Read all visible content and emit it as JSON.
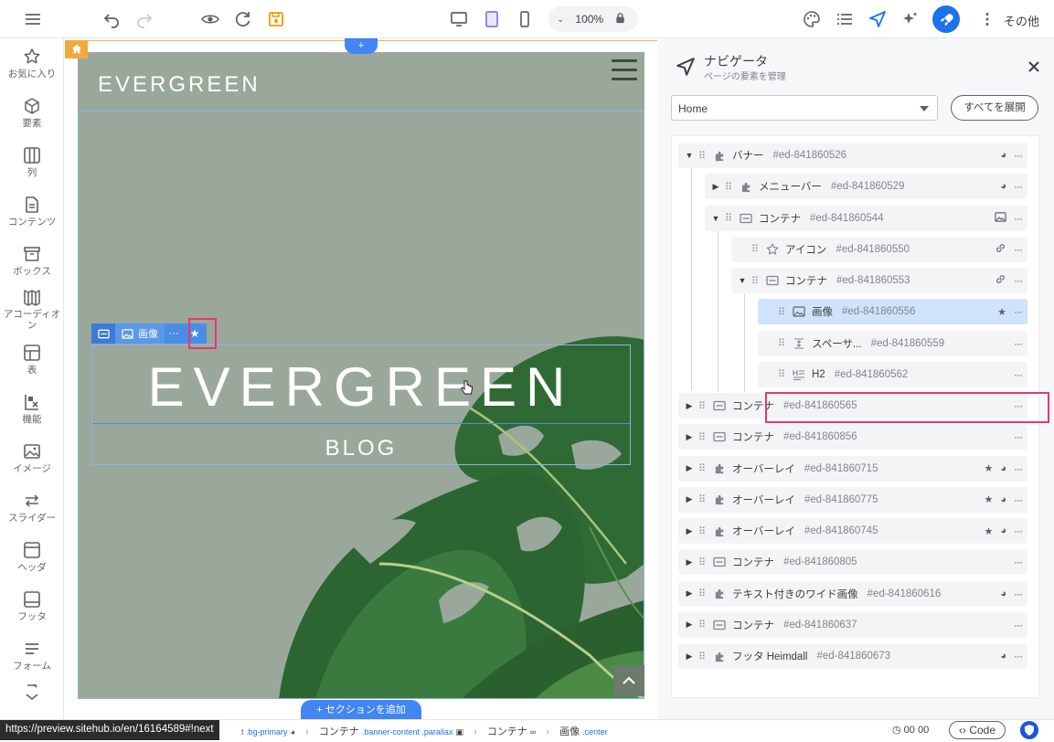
{
  "topbar": {
    "zoom": "100%",
    "more_label": "その他"
  },
  "sidebar": {
    "items": [
      {
        "label": "お気に入り",
        "icon": "star-icon"
      },
      {
        "label": "要素",
        "icon": "cube-icon"
      },
      {
        "label": "列",
        "icon": "columns-icon"
      },
      {
        "label": "コンテンツ",
        "icon": "document-icon"
      },
      {
        "label": "ボックス",
        "icon": "archive-box-icon"
      },
      {
        "label": "アコーディオン",
        "icon": "accordion-icon"
      },
      {
        "label": "表",
        "icon": "table-icon"
      },
      {
        "label": "機能",
        "icon": "features-icon"
      },
      {
        "label": "イメージ",
        "icon": "image-icon"
      },
      {
        "label": "スライダー",
        "icon": "slider-arrows-icon"
      },
      {
        "label": "ヘッダ",
        "icon": "header-icon"
      },
      {
        "label": "フッタ",
        "icon": "footer-icon"
      },
      {
        "label": "フォーム",
        "icon": "form-icon"
      }
    ]
  },
  "canvas": {
    "plus_label": "+",
    "brand": "EVERGREEN",
    "hero_title": "EVERGREEN",
    "hero_subtitle": "BLOG",
    "toolbar_image_label": "画像",
    "toolbar_more": "···",
    "toolbar_star": "★",
    "add_section": "+ セクションを追加"
  },
  "navigator": {
    "title": "ナビゲータ",
    "subtitle": "ページの要素を管理",
    "page_select": "Home",
    "expand_all": "すべてを展開",
    "rows": [
      {
        "name": "バナー",
        "id": "#ed-841860526",
        "arrow": "▼",
        "icon": "puzzle-icon",
        "actions": [
          "palette",
          "more"
        ]
      },
      {
        "name": "メニューバー",
        "id": "#ed-841860529",
        "arrow": "▶",
        "icon": "puzzle-icon",
        "actions": [
          "palette",
          "more"
        ]
      },
      {
        "name": "コンテナ",
        "id": "#ed-841860544",
        "arrow": "▼",
        "icon": "container-icon",
        "actions": [
          "image",
          "more"
        ]
      },
      {
        "name": "アイコン",
        "id": "#ed-841860550",
        "arrow": "",
        "icon": "star-outline-icon",
        "actions": [
          "link",
          "more"
        ]
      },
      {
        "name": "コンテナ",
        "id": "#ed-841860553",
        "arrow": "▼",
        "icon": "container-icon",
        "actions": [
          "link",
          "more"
        ]
      },
      {
        "name": "画像",
        "id": "#ed-841860556",
        "arrow": "",
        "icon": "image-icon",
        "actions": [
          "star",
          "more"
        ],
        "selected": true
      },
      {
        "name": "スペーサ...",
        "id": "#ed-841860559",
        "arrow": "",
        "icon": "spacer-icon",
        "actions": [
          "more"
        ]
      },
      {
        "name": "H2",
        "id": "#ed-841860562",
        "arrow": "",
        "icon": "heading-icon",
        "actions": [
          "more"
        ]
      },
      {
        "name": "コンテナ",
        "id": "#ed-841860565",
        "arrow": "▶",
        "icon": "container-icon",
        "actions": [
          "more"
        ]
      },
      {
        "name": "コンテナ",
        "id": "#ed-841860856",
        "arrow": "▶",
        "icon": "container-icon",
        "actions": [
          "more"
        ]
      },
      {
        "name": "オーバーレイ",
        "id": "#ed-841860715",
        "arrow": "▶",
        "icon": "puzzle-icon",
        "actions": [
          "star",
          "palette",
          "more"
        ]
      },
      {
        "name": "オーバーレイ",
        "id": "#ed-841860775",
        "arrow": "▶",
        "icon": "puzzle-icon",
        "actions": [
          "star",
          "palette",
          "more"
        ]
      },
      {
        "name": "オーバーレイ",
        "id": "#ed-841860745",
        "arrow": "▶",
        "icon": "puzzle-icon",
        "actions": [
          "star",
          "palette",
          "more"
        ]
      },
      {
        "name": "コンテナ",
        "id": "#ed-841860805",
        "arrow": "▶",
        "icon": "container-icon",
        "actions": [
          "more"
        ]
      },
      {
        "name": "テキスト付きのワイド画像",
        "id": "#ed-841860616",
        "arrow": "▶",
        "icon": "puzzle-icon",
        "actions": [
          "palette",
          "more"
        ]
      },
      {
        "name": "コンテナ",
        "id": "#ed-841860637",
        "arrow": "▶",
        "icon": "container-icon",
        "actions": [
          "more"
        ]
      },
      {
        "name": "フッタ Heimdall",
        "id": "#ed-841860673",
        "arrow": "▶",
        "icon": "puzzle-icon",
        "actions": [
          "palette",
          "more"
        ]
      }
    ]
  },
  "statusbar": {
    "url": "https://preview.sitehub.io/en/16164589#!next",
    "crumb1_class": "t .bg-primary",
    "crumb2": "コンテナ",
    "crumb2_class": ".banner-content .parallax",
    "crumb3": "コンテナ",
    "crumb4": "画像",
    "crumb4_class": ".center",
    "timer": "00 00",
    "code_label": "Code"
  },
  "colors": {
    "accent": "#1a73e8",
    "highlight": "#e8386d",
    "selected_row": "#cfe3fb",
    "hero_bg": "#9aa89b"
  }
}
